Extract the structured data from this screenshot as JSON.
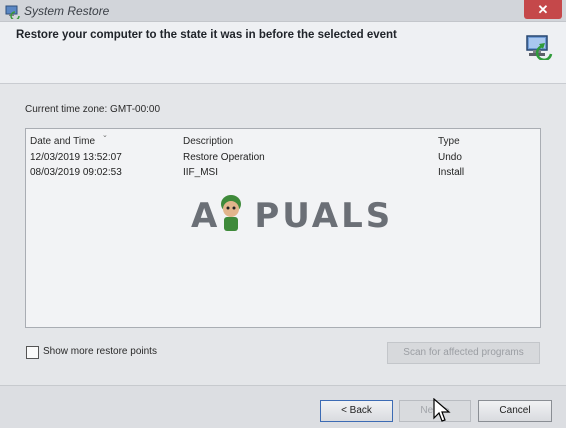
{
  "window": {
    "title": "System Restore",
    "close_glyph": "✕",
    "header": "Restore your computer to the state it was in before the selected event"
  },
  "timezone": "Current time zone: GMT-00:00",
  "list": {
    "columns": [
      "Date and Time",
      "Description",
      "Type"
    ],
    "rows": [
      {
        "date": "12/03/2019 13:52:07",
        "description": "Restore Operation",
        "type": "Undo"
      },
      {
        "date": "08/03/2019 09:02:53",
        "description": "IIF_MSI",
        "type": "Install"
      }
    ]
  },
  "checkbox": {
    "label": "Show more restore points",
    "checked": false
  },
  "buttons": {
    "scan": "Scan for affected programs",
    "back": "< Back",
    "next": "Next >",
    "cancel": "Cancel"
  },
  "watermark": {
    "left": "A",
    "right": "PUALS"
  },
  "colors": {
    "close": "#c5484a",
    "accent_border": "#3c6bb4"
  }
}
